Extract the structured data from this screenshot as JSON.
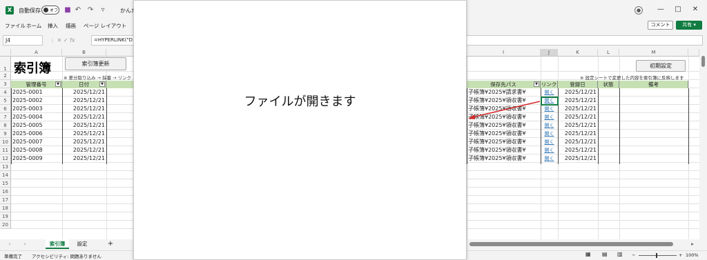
{
  "titlebar": {
    "autosave_label": "自動保存",
    "autosave_state": "オフ",
    "file_name": "かんた",
    "window_controls": [
      "—",
      "□",
      "✕"
    ]
  },
  "menu": {
    "items": [
      "ファイル",
      "ホーム",
      "挿入",
      "描画",
      "ページ レイアウト"
    ],
    "comment_label": "コメント",
    "share_label": "共有"
  },
  "formula_bar": {
    "cell_ref": "J4",
    "fx": "fx",
    "formula": "=HYPERLINK(\"D"
  },
  "grid": {
    "columns": [
      "A",
      "B",
      "I",
      "J",
      "K",
      "L",
      "M"
    ],
    "row_numbers": [
      "1",
      "2",
      "3",
      "4",
      "5",
      "6",
      "7",
      "8",
      "9",
      "10",
      "11",
      "12",
      "13",
      "14",
      "15",
      "16",
      "17",
      "18",
      "19",
      "20"
    ],
    "title": "索引簿",
    "update_button": "索引簿更新",
    "note_left": "※ 差分取り込み → 採番 → リンク",
    "init_button": "初期設定",
    "note_right": "※ 設定シートで変更した内容を索引簿に反映します",
    "headers": {
      "kanri": "管理番号",
      "date": "日付",
      "path": "保存先パス",
      "link": "リンク",
      "reg_date": "登録日",
      "status": "状態",
      "remarks": "備考"
    },
    "rows": [
      {
        "id": "2025-0001",
        "date": "2025/12/21",
        "path": "子帳簿¥2025¥請求書¥",
        "link": "開く",
        "reg": "2025/12/21"
      },
      {
        "id": "2025-0002",
        "date": "2025/12/21",
        "path": "子帳簿¥2025¥領収書¥",
        "link": "開く",
        "reg": "2025/12/21"
      },
      {
        "id": "2025-0003",
        "date": "2025/12/21",
        "path": "子帳簿¥2025¥領収書¥",
        "link": "開く",
        "reg": "2025/12/21"
      },
      {
        "id": "2025-0004",
        "date": "2025/12/21",
        "path": "子帳簿¥2025¥領収書¥",
        "link": "開く",
        "reg": "2025/12/21"
      },
      {
        "id": "2025-0005",
        "date": "2025/12/21",
        "path": "子帳簿¥2025¥領収書¥",
        "link": "開く",
        "reg": "2025/12/21"
      },
      {
        "id": "2025-0006",
        "date": "2025/12/21",
        "path": "子帳簿¥2025¥領収書¥",
        "link": "開く",
        "reg": "2025/12/21"
      },
      {
        "id": "2025-0007",
        "date": "2025/12/21",
        "path": "子帳簿¥2025¥領収書¥",
        "link": "開く",
        "reg": "2025/12/21"
      },
      {
        "id": "2025-0008",
        "date": "2025/12/21",
        "path": "子帳簿¥2025¥領収書¥",
        "link": "開く",
        "reg": "2025/12/21"
      },
      {
        "id": "2025-0009",
        "date": "2025/12/21",
        "path": "子帳簿¥2025¥領収書¥",
        "link": "開く",
        "reg": "2025/12/21"
      }
    ]
  },
  "sheets": {
    "tabs": [
      "索引簿",
      "設定"
    ],
    "add": "+"
  },
  "status": {
    "ready": "準備完了",
    "accessibility": "アクセシビリティ: 問題ありません",
    "zoom": "100%"
  },
  "overlay": {
    "message": "ファイルが開きます"
  },
  "colors": {
    "excel_green": "#107c41",
    "table_header": "#c6e0b4",
    "arrow": "#d62b2b"
  }
}
